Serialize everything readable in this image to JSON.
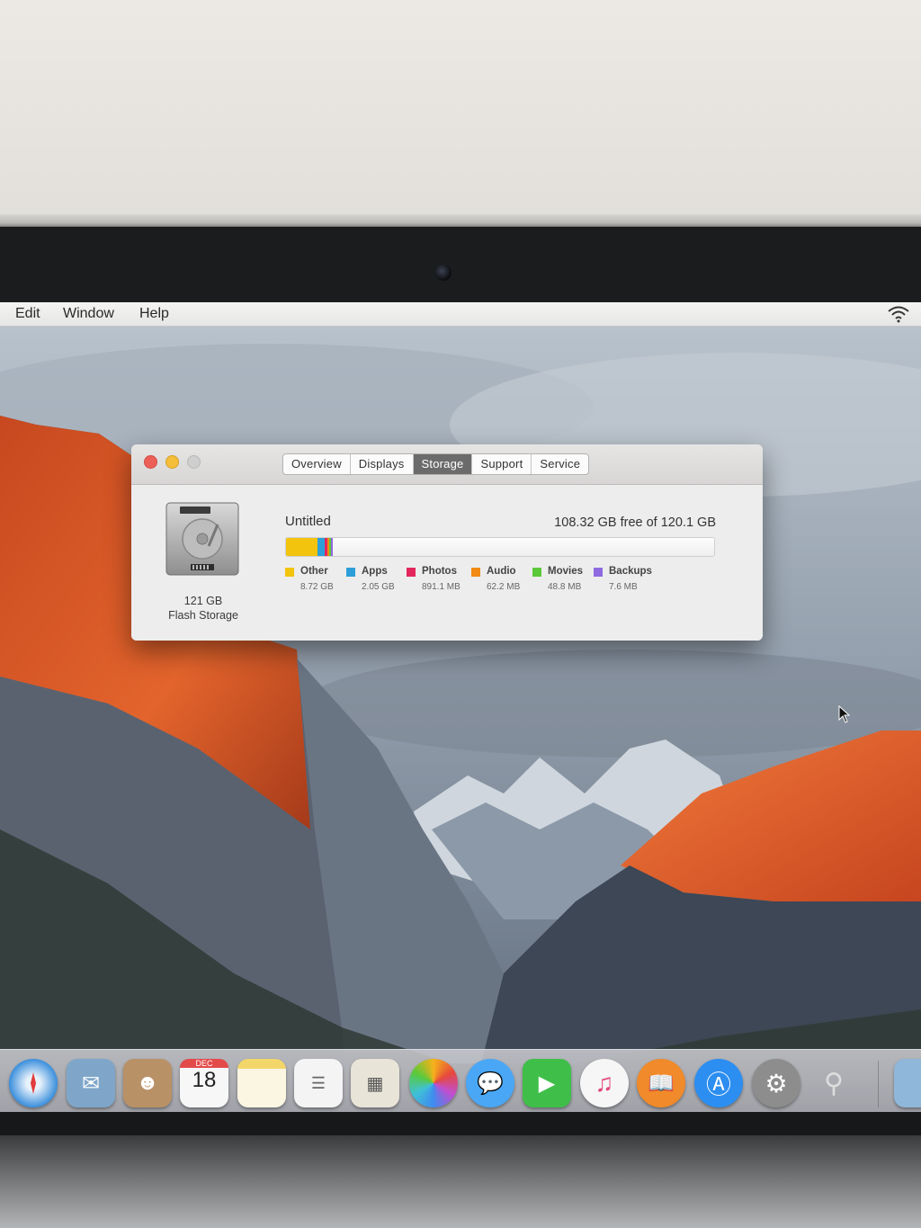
{
  "menubar": {
    "items": [
      "Edit",
      "Window",
      "Help"
    ],
    "wifi_icon": "wifi-icon"
  },
  "window": {
    "tabs": [
      {
        "label": "Overview",
        "active": false
      },
      {
        "label": "Displays",
        "active": false
      },
      {
        "label": "Storage",
        "active": true
      },
      {
        "label": "Support",
        "active": false
      },
      {
        "label": "Service",
        "active": false
      }
    ],
    "disk": {
      "icon": "hard-drive-icon",
      "size": "121 GB",
      "type": "Flash Storage"
    },
    "volume": {
      "name": "Untitled",
      "free_text": "108.32 GB free of 120.1 GB"
    },
    "storage": {
      "total_gb": 120.1,
      "categories": [
        {
          "name": "Other",
          "size": "8.72 GB",
          "gb": 8.72,
          "color": "#f2c40d"
        },
        {
          "name": "Apps",
          "size": "2.05 GB",
          "gb": 2.05,
          "color": "#2d9fd8"
        },
        {
          "name": "Photos",
          "size": "891.1 MB",
          "gb": 0.8911,
          "color": "#e3275c"
        },
        {
          "name": "Audio",
          "size": "62.2 MB",
          "gb": 0.0622,
          "color": "#f28a13"
        },
        {
          "name": "Movies",
          "size": "48.8 MB",
          "gb": 0.0488,
          "color": "#5cc93a"
        },
        {
          "name": "Backups",
          "size": "7.6 MB",
          "gb": 0.0076,
          "color": "#8f6ae0"
        }
      ]
    }
  },
  "dock": {
    "calendar_month": "DEC",
    "calendar_day": "18",
    "apps": [
      {
        "name": "safari-icon",
        "color": "#2f86d6"
      },
      {
        "name": "mail-icon",
        "color": "#7fa6c9"
      },
      {
        "name": "contacts-icon",
        "color": "#b99167"
      },
      {
        "name": "calendar-icon",
        "color": "#f4f4f4"
      },
      {
        "name": "notes-icon",
        "color": "#f7e7a1"
      },
      {
        "name": "reminders-icon",
        "color": "#f2f2f2"
      },
      {
        "name": "preview-icon",
        "color": "#e8e4d8"
      },
      {
        "name": "photos-icon",
        "color": "#fafafa"
      },
      {
        "name": "messages-icon",
        "color": "#4aa7f5"
      },
      {
        "name": "facetime-icon",
        "color": "#3fbf4a"
      },
      {
        "name": "itunes-icon",
        "color": "#f3f3f3"
      },
      {
        "name": "ibooks-icon",
        "color": "#f08a2a"
      },
      {
        "name": "app-store-icon",
        "color": "#2c8ef0"
      },
      {
        "name": "system-preferences-icon",
        "color": "#8d8d8d"
      },
      {
        "name": "utility-icon",
        "color": "#c9c9c9"
      }
    ]
  }
}
